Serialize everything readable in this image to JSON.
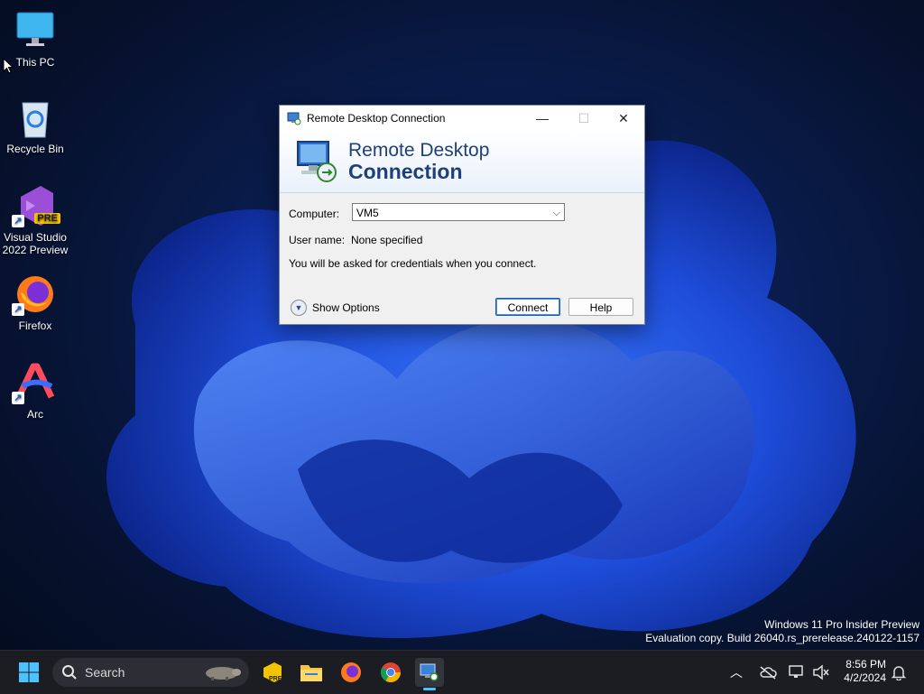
{
  "desktop": {
    "icons": [
      {
        "label": "This PC"
      },
      {
        "label": "Recycle Bin"
      },
      {
        "label_line1": "Visual Studio",
        "label_line2": "2022 Preview",
        "badge": "PRE"
      },
      {
        "label": "Firefox"
      },
      {
        "label": "Arc"
      }
    ]
  },
  "window": {
    "title": "Remote Desktop Connection",
    "banner_line1": "Remote Desktop",
    "banner_line2": "Connection",
    "computer_label": "Computer:",
    "computer_value": "VM5",
    "username_label": "User name:",
    "username_value": "None specified",
    "info_text": "You will be asked for credentials when you connect.",
    "show_options_label": "Show Options",
    "connect_label": "Connect",
    "help_label": "Help"
  },
  "watermark": {
    "line1": "Windows 11 Pro Insider Preview",
    "line2": "Evaluation copy. Build 26040.rs_prerelease.240122-1157"
  },
  "taskbar": {
    "search_placeholder": "Search",
    "time": "8:56 PM",
    "date": "4/2/2024"
  },
  "colors": {
    "accent": "#1b5fb5",
    "banner_text": "#1d3f7a",
    "taskbar": "#1c1d22"
  }
}
